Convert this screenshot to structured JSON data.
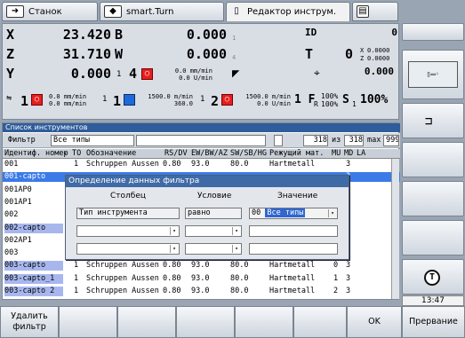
{
  "tabs": [
    {
      "label": "Станок"
    },
    {
      "label": "smart.Turn"
    },
    {
      "label": "Редактор инструм.",
      "active": true
    },
    {
      "label": ""
    }
  ],
  "status": {
    "x": {
      "label": "X",
      "value": "23.420",
      "axis2": "B",
      "value2": "0.000",
      "sub2": "1"
    },
    "z": {
      "label": "Z",
      "value": "31.710",
      "axis2": "W",
      "value2": "0.000",
      "sub2": "4"
    },
    "y": {
      "label": "Y",
      "value": "0.000",
      "spindle": "1",
      "num4": "4",
      "feed1": "0.0 mm/min",
      "feed2": "0.0 U/min"
    },
    "id_label": "ID",
    "id_value": "0",
    "t_label": "T",
    "t_value": "0",
    "t_x": "0.0000",
    "t_z": "0.0000",
    "t_xl": "X",
    "t_zl": "Z",
    "dist_value": "0.000",
    "bottom": {
      "s1": "1",
      "mm1": "0.0 mm/min",
      "mm2": "0.0 mm/min",
      "n1": "1",
      "n1b": "1",
      "rpm1": "1500.0 m/min",
      "rpm2": "360.0",
      "n2": "1",
      "n2b": "2",
      "rpm3": "1500.0 m/min",
      "rpm4": "0.0 U/min",
      "f_label": "1 F",
      "f_pct1": "100%",
      "f_pct2": "100%",
      "r_label": "R",
      "s_label": "S",
      "s_sub": "1",
      "s_pct": "100%"
    }
  },
  "list": {
    "title": "Список инструментов",
    "filter_label": "Фильтр",
    "filter_value": "Все типы",
    "count": "318",
    "of_label": "из",
    "total": "318",
    "max_label": "max",
    "max": "999",
    "columns": [
      "Идентиф. номер",
      "ТО",
      "Обозначение",
      "RS/DV",
      "EW/BW/AZ",
      "SW/SB/HG",
      "Режущий мат.",
      "MU",
      "MD",
      "LA"
    ],
    "rows": [
      {
        "id": "001",
        "to": "1",
        "name": "Schruppen Aussen",
        "rs": "0.80",
        "ew": "93.0",
        "sw": "80.0",
        "mat": "Hartmetall",
        "mu": "",
        "md": "3"
      },
      {
        "id": "001-capto",
        "to": "",
        "name": "",
        "rs": "",
        "ew": "",
        "sw": "",
        "mat": "",
        "mu": "",
        "md": "3",
        "sel": true
      },
      {
        "id": "001AP0",
        "to": "",
        "name": "",
        "rs": "",
        "ew": "",
        "sw": "",
        "mat": "",
        "mu": "",
        "md": "3"
      },
      {
        "id": "001AP1",
        "to": "",
        "name": "",
        "rs": "",
        "ew": "",
        "sw": "",
        "mat": "",
        "mu": "",
        "md": "3"
      },
      {
        "id": "002",
        "to": "",
        "name": "",
        "rs": "",
        "ew": "",
        "sw": "",
        "mat": "",
        "mu": "",
        "md": "3"
      },
      {
        "id": "002-capto",
        "to": "",
        "name": "",
        "rs": "",
        "ew": "",
        "sw": "",
        "mat": "",
        "mu": "",
        "md": "3",
        "hl": true
      },
      {
        "id": "002AP1",
        "to": "",
        "name": "",
        "rs": "",
        "ew": "",
        "sw": "",
        "mat": "",
        "mu": "",
        "md": "3"
      },
      {
        "id": "003",
        "to": "",
        "name": "",
        "rs": "",
        "ew": "",
        "sw": "",
        "mat": "",
        "mu": "",
        "md": "3"
      },
      {
        "id": "003-capto",
        "to": "1",
        "name": "Schruppen Aussen",
        "rs": "0.80",
        "ew": "93.0",
        "sw": "80.0",
        "mat": "Hartmetall",
        "mu": "0",
        "md": "3",
        "hl": true
      },
      {
        "id": "003-capto_1",
        "to": "1",
        "name": "Schruppen Aussen",
        "rs": "0.80",
        "ew": "93.0",
        "sw": "80.0",
        "mat": "Hartmetall",
        "mu": "1",
        "md": "3",
        "hl": true
      },
      {
        "id": "003-capto 2",
        "to": "1",
        "name": "Schruppen Aussen",
        "rs": "0.80",
        "ew": "93.0",
        "sw": "80.0",
        "mat": "Hartmetall",
        "mu": "2",
        "md": "3",
        "hl": true
      }
    ]
  },
  "dialog": {
    "title": "Определение данных фильтра",
    "col_label": "Столбец",
    "cond_label": "Условие",
    "val_label": "Значение",
    "row1": {
      "col": "Тип инструмента",
      "cond": "равно",
      "val_code": "00",
      "val": "Все типы"
    },
    "row2": {
      "col": "",
      "cond": "",
      "val": ""
    },
    "row3": {
      "col": "",
      "cond": "",
      "val": ""
    }
  },
  "clock": "13:47",
  "softkeys": [
    "Удалить\nфильтр",
    "",
    "",
    "",
    "",
    "",
    "OK",
    "Прервание"
  ],
  "icons": {
    "tab1": "machine-arrow-icon",
    "tab2": "smart-turn-arrow-icon",
    "tab3": "tool-editor-icon",
    "tab4": "save-icon"
  }
}
